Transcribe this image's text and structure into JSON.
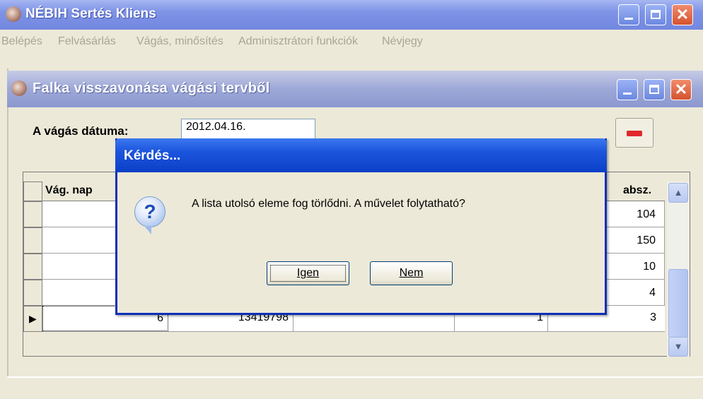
{
  "main_window": {
    "title": "NÉBIH Sertés Kliens",
    "icon": "pig-icon",
    "menu": [
      "Belépés",
      "Felvásárlás",
      "Vágás, minősítés",
      "Adminisztrátori funkciók",
      "Névjegy"
    ]
  },
  "child_window": {
    "title": "Falka visszavonása vágási tervből",
    "icon": "pig-icon",
    "date_label": "A vágás dátuma:",
    "date_value": "2012.04.16.",
    "delete_button_icon": "minus-icon"
  },
  "grid": {
    "headers": [
      "Vág. nap",
      "absz."
    ],
    "rows": [
      {
        "left": "",
        "right": "104"
      },
      {
        "left": "",
        "right": "150"
      },
      {
        "left": "",
        "right": "10"
      },
      {
        "left": "",
        "right": "4"
      },
      {
        "left": "6",
        "mid": "13419798",
        "qty": "1",
        "right": "3"
      }
    ]
  },
  "dialog": {
    "title": "Kérdés...",
    "icon": "question-icon",
    "message": "A lista utolsó eleme fog törlődni. A művelet folytatható?",
    "yes_label": "Igen",
    "no_label": "Nem"
  },
  "colors": {
    "dialog_title": "#0a40c8",
    "main_title": "#7e93e6",
    "close_button": "#d6522e",
    "delete_icon": "#e0282d"
  }
}
